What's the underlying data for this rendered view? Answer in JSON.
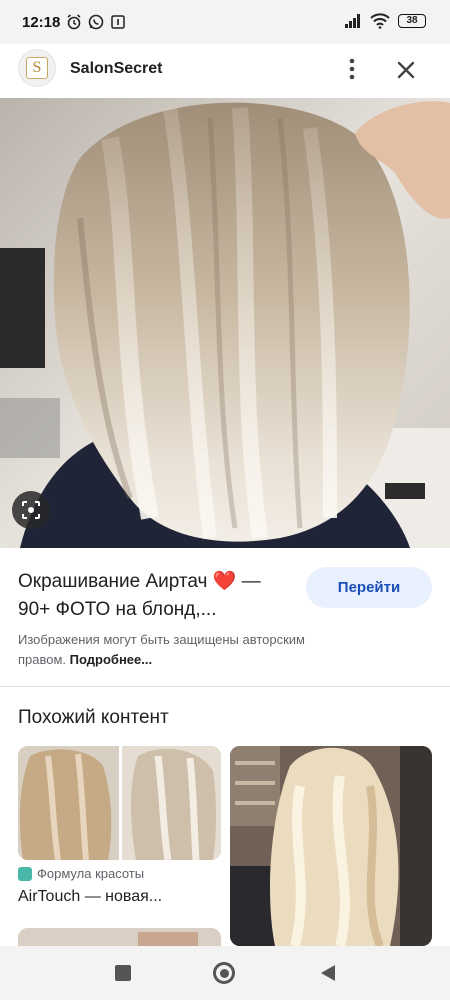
{
  "status_bar": {
    "time": "12:18",
    "left_icons": [
      "alarm-icon",
      "whatsapp-icon",
      "notification-icon"
    ],
    "right_icons": [
      "signal-icon",
      "wifi-icon",
      "battery-icon"
    ],
    "battery_level": "38"
  },
  "header": {
    "favicon_letter": "S",
    "site_name": "SalonSecret",
    "more_icon": "more-vert-icon",
    "close_icon": "close-icon"
  },
  "main_image": {
    "lens_icon": "google-lens-icon"
  },
  "result": {
    "title": "Окрашивание Аиртач ❤️ — 90+ ФОТО на блонд,...",
    "visit_label": "Перейти",
    "copyright_text": "Изображения могут быть защищены авторским правом.",
    "more_link": "Подробнее..."
  },
  "related": {
    "heading": "Похожий контент",
    "items": [
      {
        "source": "Формула красоты",
        "title": "AirTouch — новая..."
      }
    ]
  },
  "nav_bar": {
    "icons": [
      "recents-icon",
      "home-icon",
      "back-icon"
    ]
  },
  "colors": {
    "accent_button_bg": "#e8f0fe",
    "accent_button_text": "#1a4fb8",
    "status_bar_bg": "#f3f3f3"
  }
}
